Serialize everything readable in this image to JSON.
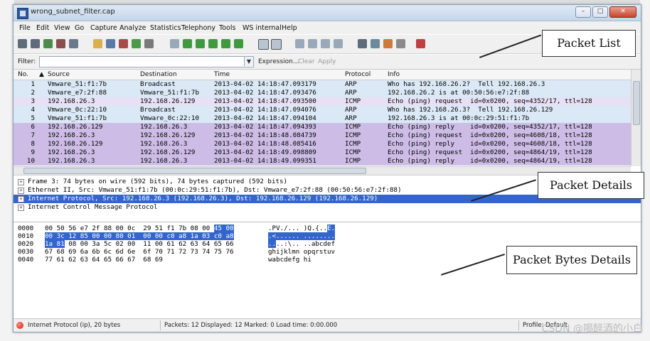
{
  "window": {
    "title": "wrong_subnet_filter.cap"
  },
  "menu": [
    "File",
    "Edit",
    "View",
    "Go",
    "Capture",
    "Analyze",
    "Statistics",
    "Telephony",
    "Tools",
    "WS internal",
    "Help"
  ],
  "filter": {
    "label": "Filter:",
    "value": "",
    "expression": "Expression...",
    "clear": "Clear",
    "apply": "Apply"
  },
  "packet_list": {
    "columns": [
      "No.",
      "Source",
      "Destination",
      "Time",
      "Protocol",
      "Info"
    ],
    "rows": [
      {
        "no": "1",
        "src": "Vmware_51:f1:7b",
        "dst": "Broadcast",
        "time": "2013-04-02 14:18:47.093179",
        "proto": "ARP",
        "info": "Who has 192.168.26.2?  Tell 192.168.26.3",
        "color": "#dbe9f7"
      },
      {
        "no": "2",
        "src": "Vmware_e7:2f:88",
        "dst": "Vmware_51:f1:7b",
        "time": "2013-04-02 14:18:47.093476",
        "proto": "ARP",
        "info": "192.168.26.2 is at 00:50:56:e7:2f:88",
        "color": "#dbe9f7"
      },
      {
        "no": "3",
        "src": "192.168.26.3",
        "dst": "192.168.26.129",
        "time": "2013-04-02 14:18:47.093500",
        "proto": "ICMP",
        "info": "Echo (ping) request  id=0x0200, seq=4352/17, ttl=128",
        "color": "#e8e0f4"
      },
      {
        "no": "4",
        "src": "Vmware_0c:22:10",
        "dst": "Broadcast",
        "time": "2013-04-02 14:18:47.094076",
        "proto": "ARP",
        "info": "Who has 192.168.26.3?  Tell 192.168.26.129",
        "color": "#dbe9f7"
      },
      {
        "no": "5",
        "src": "Vmware_51:f1:7b",
        "dst": "Vmware_0c:22:10",
        "time": "2013-04-02 14:18:47.094104",
        "proto": "ARP",
        "info": "192.168.26.3 is at 00:0c:29:51:f1:7b",
        "color": "#dbe9f7"
      },
      {
        "no": "6",
        "src": "192.168.26.129",
        "dst": "192.168.26.3",
        "time": "2013-04-02 14:18:47.094393",
        "proto": "ICMP",
        "info": "Echo (ping) reply    id=0x0200, seq=4352/17, ttl=128",
        "color": "#cdbde6"
      },
      {
        "no": "7",
        "src": "192.168.26.3",
        "dst": "192.168.26.129",
        "time": "2013-04-02 14:18:48.084739",
        "proto": "ICMP",
        "info": "Echo (ping) request  id=0x0200, seq=4608/18, ttl=128",
        "color": "#cdbde6"
      },
      {
        "no": "8",
        "src": "192.168.26.129",
        "dst": "192.168.26.3",
        "time": "2013-04-02 14:18:48.085416",
        "proto": "ICMP",
        "info": "Echo (ping) reply    id=0x0200, seq=4608/18, ttl=128",
        "color": "#cdbde6"
      },
      {
        "no": "9",
        "src": "192.168.26.3",
        "dst": "192.168.26.129",
        "time": "2013-04-02 14:18:49.098809",
        "proto": "ICMP",
        "info": "Echo (ping) request  id=0x0200, seq=4864/19, ttl=128",
        "color": "#cdbde6"
      },
      {
        "no": "10",
        "src": "192.168.26.3",
        "dst": "192.168.26.3",
        "time": "2013-04-02 14:18:49.099351",
        "proto": "ICMP",
        "info": "Echo (ping) reply    id=0x0200, seq=4864/19, ttl=128",
        "color": "#cdbde6"
      }
    ]
  },
  "details": [
    {
      "text": "Frame 3: 74 bytes on wire (592 bits), 74 bytes captured (592 bits)",
      "selected": false
    },
    {
      "text": "Ethernet II, Src: Vmware_51:f1:7b (00:0c:29:51:f1:7b), Dst: Vmware_e7:2f:88 (00:50:56:e7:2f:88)",
      "selected": false
    },
    {
      "text": "Internet Protocol, Src: 192.168.26.3 (192.168.26.3), Dst: 192.168.26.129 (192.168.26.129)",
      "selected": true
    },
    {
      "text": "Internet Control Message Protocol",
      "selected": false
    }
  ],
  "bytes": [
    {
      "offset": "0000",
      "hex_a": "00 50 56 e7 2f 88 00 0c  29 51 f1 7b 08 00 ",
      "hex_hl": "45 00",
      "hex_b": "",
      "ascii_a": ".PV./... )Q.{..",
      "ascii_hl": "E.",
      "ascii_b": ""
    },
    {
      "offset": "0010",
      "hex_a": "",
      "hex_hl": "00 3c 12 85 00 00 80 01  00 00 c0 a8 1a 03 c0 a8",
      "hex_b": "",
      "ascii_a": "",
      "ascii_hl": ".<...... ........",
      "ascii_b": ""
    },
    {
      "offset": "0020",
      "hex_a": "",
      "hex_hl": "1a 81",
      "hex_b": " 08 00 3a 5c 02 00  11 00 61 62 63 64 65 66",
      "ascii_a": "",
      "ascii_hl": "..",
      "ascii_b": "..:\\.. ..abcdef"
    },
    {
      "offset": "0030",
      "hex_a": "67 68 69 6a 6b 6c 6d 6e  6f 70 71 72 73 74 75 76",
      "hex_hl": "",
      "hex_b": "",
      "ascii_a": "ghijklmn opqrstuv",
      "ascii_hl": "",
      "ascii_b": ""
    },
    {
      "offset": "0040",
      "hex_a": "77 61 62 63 64 65 66 67  68 69",
      "hex_hl": "",
      "hex_b": "",
      "ascii_a": "wabcdefg hi",
      "ascii_hl": "",
      "ascii_b": ""
    }
  ],
  "status": {
    "left": "Internet Protocol (ip), 20 bytes",
    "middle": "Packets: 12 Displayed: 12 Marked: 0 Load time: 0:00.000",
    "right": "Profile: Default"
  },
  "callouts": {
    "packet_list": "Packet List",
    "packet_details": "Packet Details",
    "packet_bytes": "Packet Bytes Details"
  },
  "watermark": "CSDN @喝醉酒的小白"
}
